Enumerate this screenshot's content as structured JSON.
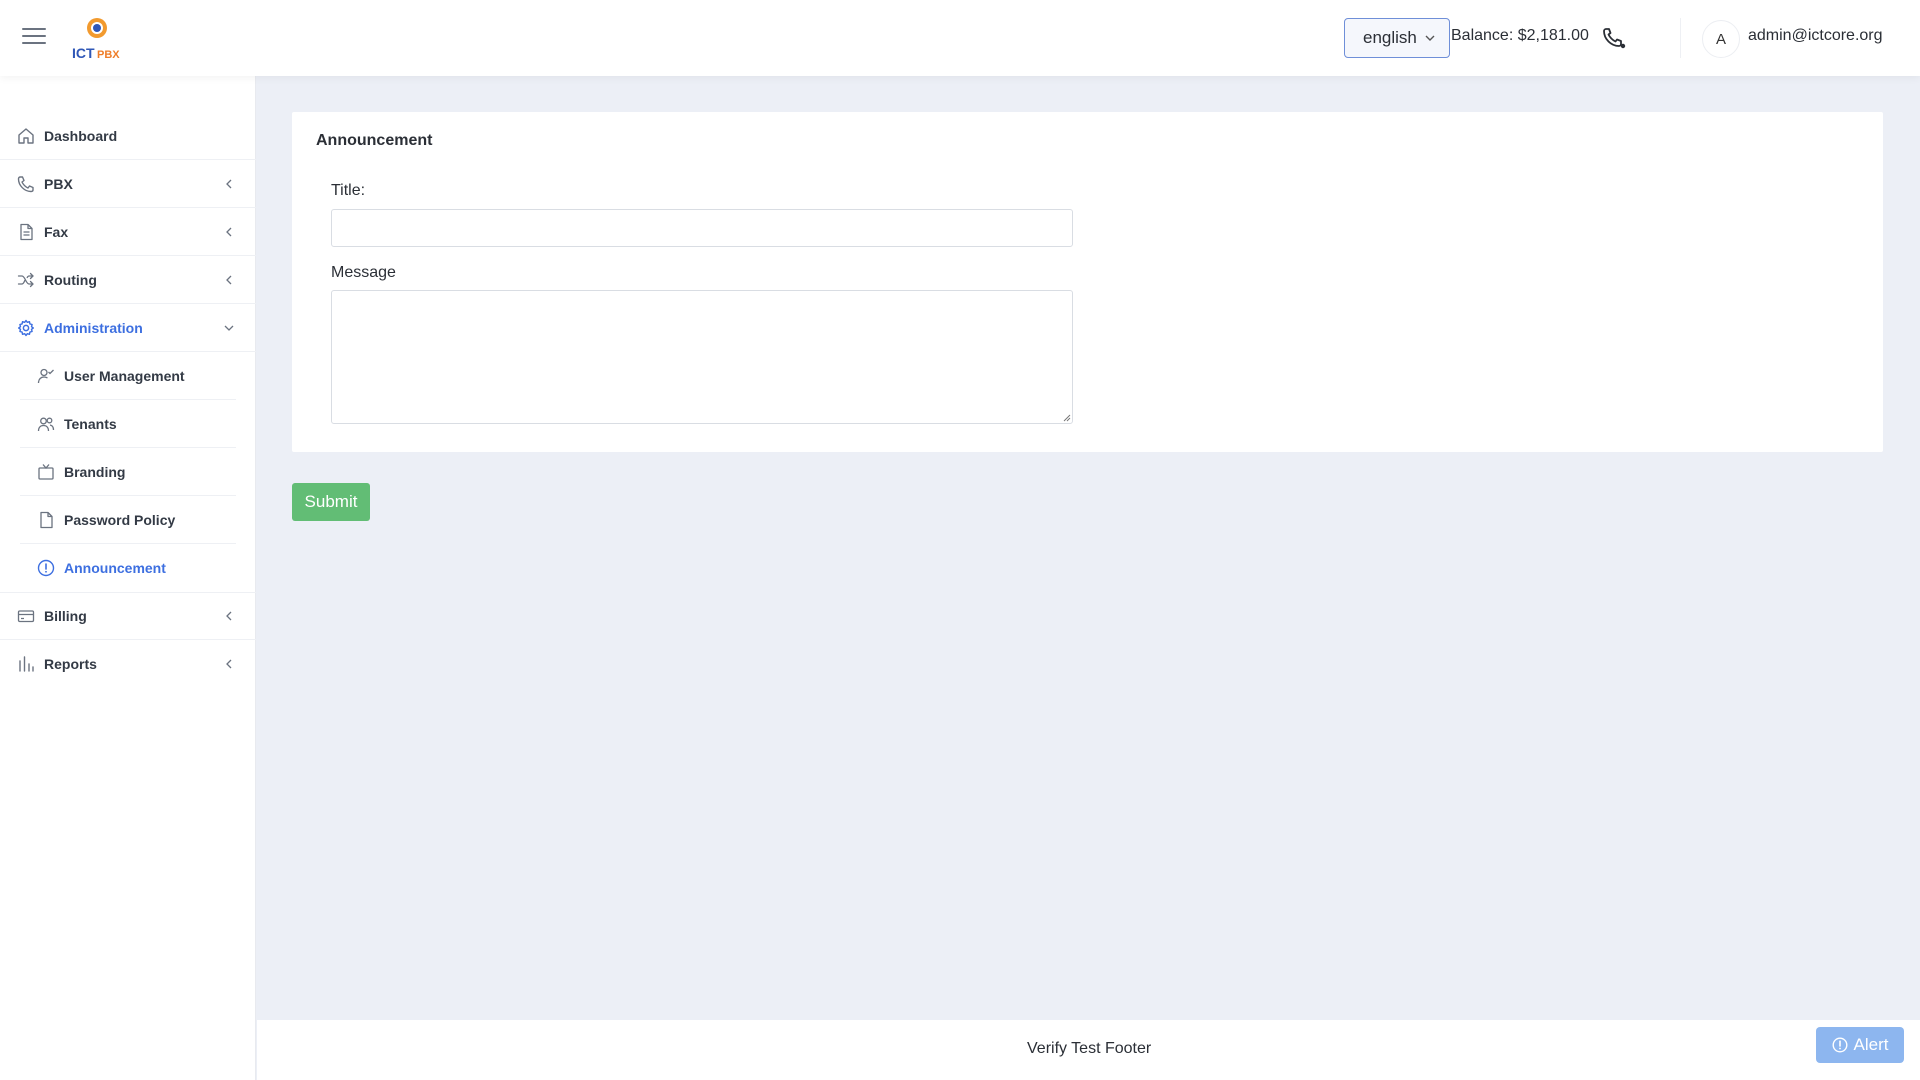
{
  "header": {
    "logo_text_1": "ICT",
    "logo_text_2": "PBX",
    "language": "english",
    "balance": "Balance: $2,181.00",
    "avatar_initial": "A",
    "user_email": "admin@ictcore.org",
    "icons": {
      "menu": "hamburger-icon",
      "phone": "phone-icon",
      "language_chevron": "chevron-down-icon"
    }
  },
  "sidebar": {
    "items": [
      {
        "label": "Dashboard",
        "icon": "home-icon"
      },
      {
        "label": "PBX",
        "icon": "phone-icon",
        "expandable": true
      },
      {
        "label": "Fax",
        "icon": "document-icon",
        "expandable": true
      },
      {
        "label": "Routing",
        "icon": "shuffle-icon",
        "expandable": true
      },
      {
        "label": "Administration",
        "icon": "gear-icon",
        "expandable": true,
        "expanded": true,
        "active": true
      },
      {
        "label": "Billing",
        "icon": "credit-card-icon",
        "expandable": true
      },
      {
        "label": "Reports",
        "icon": "bar-chart-icon",
        "expandable": true
      }
    ],
    "admin_subitems": [
      {
        "label": "User Management",
        "icon": "user-check-icon"
      },
      {
        "label": "Tenants",
        "icon": "users-icon"
      },
      {
        "label": "Branding",
        "icon": "tv-icon"
      },
      {
        "label": "Password Policy",
        "icon": "file-icon"
      },
      {
        "label": "Announcement",
        "icon": "info-circle-icon",
        "active": true
      }
    ]
  },
  "main": {
    "card_title": "Announcement",
    "title_label": "Title:",
    "title_value": "",
    "message_label": "Message",
    "message_value": "",
    "submit_label": "Submit"
  },
  "footer": {
    "text": "Verify Test Footer",
    "alert_label": "Alert"
  },
  "colors": {
    "accent": "#3d6fe0",
    "submit": "#62bd75",
    "alert": "#8db6ef",
    "background": "#eceff6"
  }
}
